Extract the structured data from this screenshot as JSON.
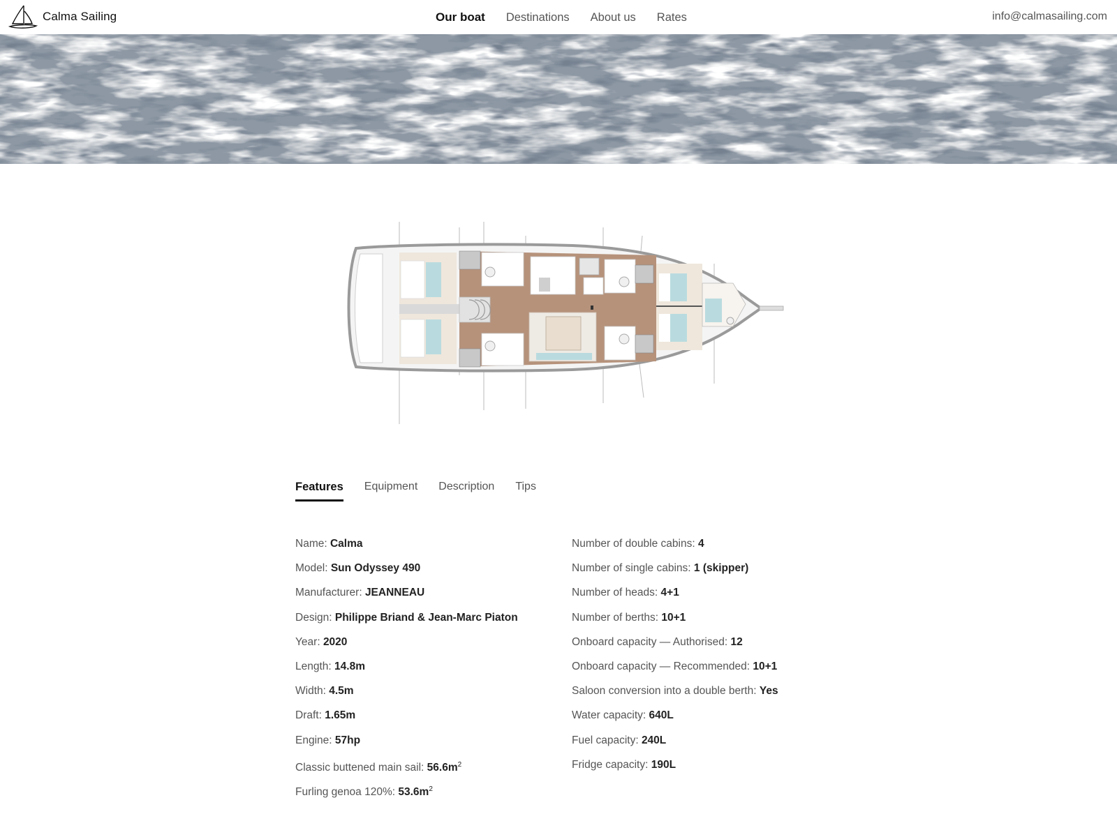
{
  "brand": {
    "name": "Calma Sailing",
    "logo_icon": "sailboat-icon"
  },
  "nav": {
    "items": [
      {
        "label": "Our boat",
        "active": true
      },
      {
        "label": "Destinations",
        "active": false
      },
      {
        "label": "About us",
        "active": false
      },
      {
        "label": "Rates",
        "active": false
      }
    ]
  },
  "contact": {
    "email": "info@calmasailing.com"
  },
  "tabs": [
    {
      "label": "Features",
      "active": true
    },
    {
      "label": "Equipment",
      "active": false
    },
    {
      "label": "Description",
      "active": false
    },
    {
      "label": "Tips",
      "active": false
    }
  ],
  "features": {
    "left": [
      {
        "label": "Name: ",
        "value": "Calma"
      },
      {
        "label": "Model: ",
        "value": "Sun Odyssey 490"
      },
      {
        "label": "Manufacturer: ",
        "value": "JEANNEAU"
      },
      {
        "label": "Design: ",
        "value": "Philippe Briand & Jean-Marc Piaton"
      },
      {
        "label": "Year: ",
        "value": "2020"
      },
      {
        "label": "Length: ",
        "value": "14.8m"
      },
      {
        "label": "Width: ",
        "value": "4.5m"
      },
      {
        "label": "Draft: ",
        "value": "1.65m"
      },
      {
        "label": "Engine: ",
        "value": "57hp"
      },
      {
        "label": "Classic buttened main sail: ",
        "value": "56.6m",
        "sup": "2"
      },
      {
        "label": "Furling genoa 120%: ",
        "value": "53.6m",
        "sup": "2"
      }
    ],
    "right": [
      {
        "label": "Number of double cabins: ",
        "value": "4"
      },
      {
        "label": "Number of single cabins: ",
        "value": "1 (skipper)"
      },
      {
        "label": "Number of heads: ",
        "value": "4+1"
      },
      {
        "label": "Number of berths: ",
        "value": "10+1"
      },
      {
        "label": "Onboard capacity — Authorised: ",
        "value": "12"
      },
      {
        "label": "Onboard capacity — Recommended: ",
        "value": "10+1"
      },
      {
        "label": "Saloon conversion into a double berth: ",
        "value": "Yes"
      },
      {
        "label": "Water capacity: ",
        "value": "640L"
      },
      {
        "label": "Fuel capacity: ",
        "value": "240L"
      },
      {
        "label": "Fridge capacity: ",
        "value": "190L"
      }
    ]
  }
}
